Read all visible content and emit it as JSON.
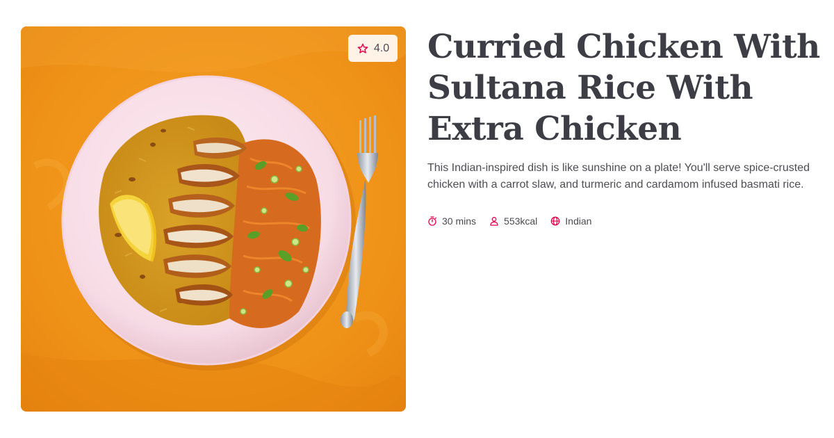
{
  "recipe": {
    "title": "Curried Chicken With Sultana Rice With Extra Chicken",
    "description": "This Indian-inspired dish is like sunshine on a plate! You'll serve spice-crusted chicken with a carrot slaw, and turmeric and cardamom infused basmati rice.",
    "rating": "4.0",
    "rating_icon": "star-icon",
    "image_icon": "recipe-photo"
  },
  "meta": {
    "time": {
      "icon": "timer-icon",
      "label": "30 mins"
    },
    "calories": {
      "icon": "person-icon",
      "label": "553kcal"
    },
    "cuisine": {
      "icon": "globe-icon",
      "label": "Indian"
    }
  },
  "colors": {
    "accent": "#e4004b",
    "title": "#3d3d45",
    "text": "#4c4c55",
    "background": "#f39a1e"
  }
}
